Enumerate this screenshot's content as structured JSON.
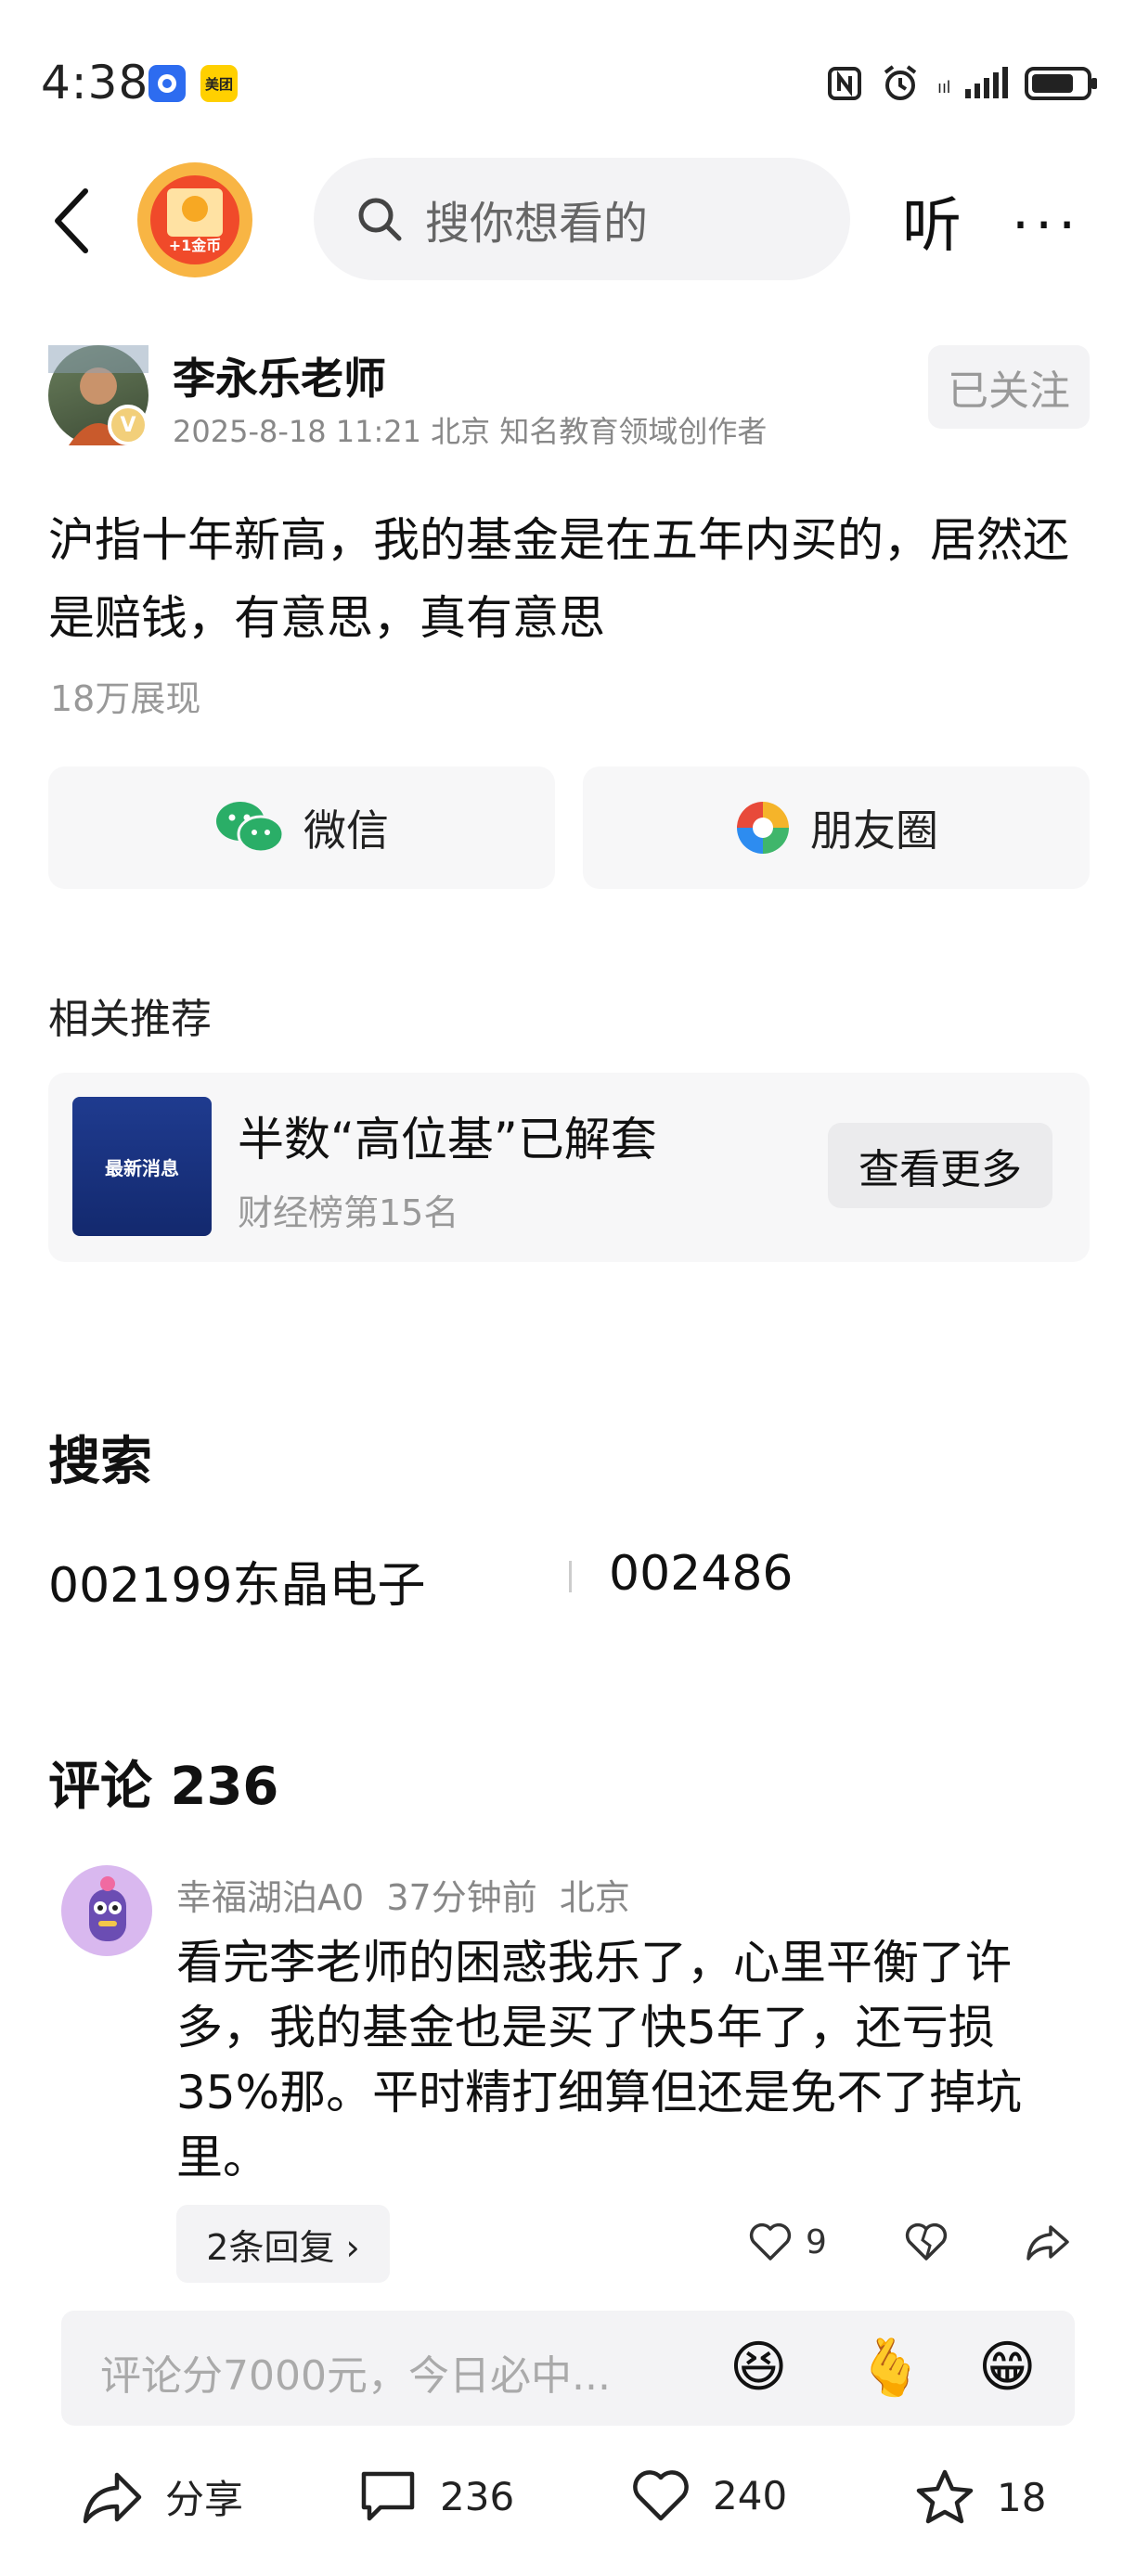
{
  "status_bar": {
    "time": "4:38",
    "app_badges": [
      "美团"
    ],
    "icons": [
      "nfc-icon",
      "alarm-icon",
      "signal-icon",
      "battery-icon"
    ]
  },
  "nav": {
    "coin_label": "+1金币",
    "search_placeholder": "搜你想看的",
    "listen_label": "听",
    "more_label": "···"
  },
  "author": {
    "name": "李永乐老师",
    "meta": "2025-8-18 11:21 北京 知名教育领域创作者",
    "follow_label": "已关注",
    "badge": "V"
  },
  "post": {
    "text": "沪指十年新高，我的基金是在五年内买的，居然还是赔钱，有意思，真有意思",
    "views": "18万展现"
  },
  "share": {
    "wechat": "微信",
    "moments": "朋友圈"
  },
  "related": {
    "section_label": "相关推荐",
    "thumb_text": "最新消息",
    "title": "半数“高位基”已解套",
    "subtitle": "财经榜第15名",
    "more_label": "查看更多"
  },
  "search_section": {
    "title": "搜索",
    "items": [
      "002199东晶电子",
      "002486"
    ]
  },
  "comments": {
    "title": "评论 236",
    "items": [
      {
        "user": "幸福湖泊A0",
        "time": "37分钟前",
        "location": "北京",
        "text": "看完李老师的困惑我乐了，心里平衡了许多，我的基金也是买了快5年了，还亏损35%那。平时精打细算但还是免不了掉坑里。",
        "replies": "2条回复 ›",
        "likes": "9"
      }
    ]
  },
  "comment_bar": {
    "placeholder": "评论分7000元，今日必中...",
    "emojis": [
      "😆",
      "🫰",
      "😁"
    ]
  },
  "bottom": {
    "share": "分享",
    "comments": "236",
    "likes": "240",
    "favorites": "18"
  }
}
